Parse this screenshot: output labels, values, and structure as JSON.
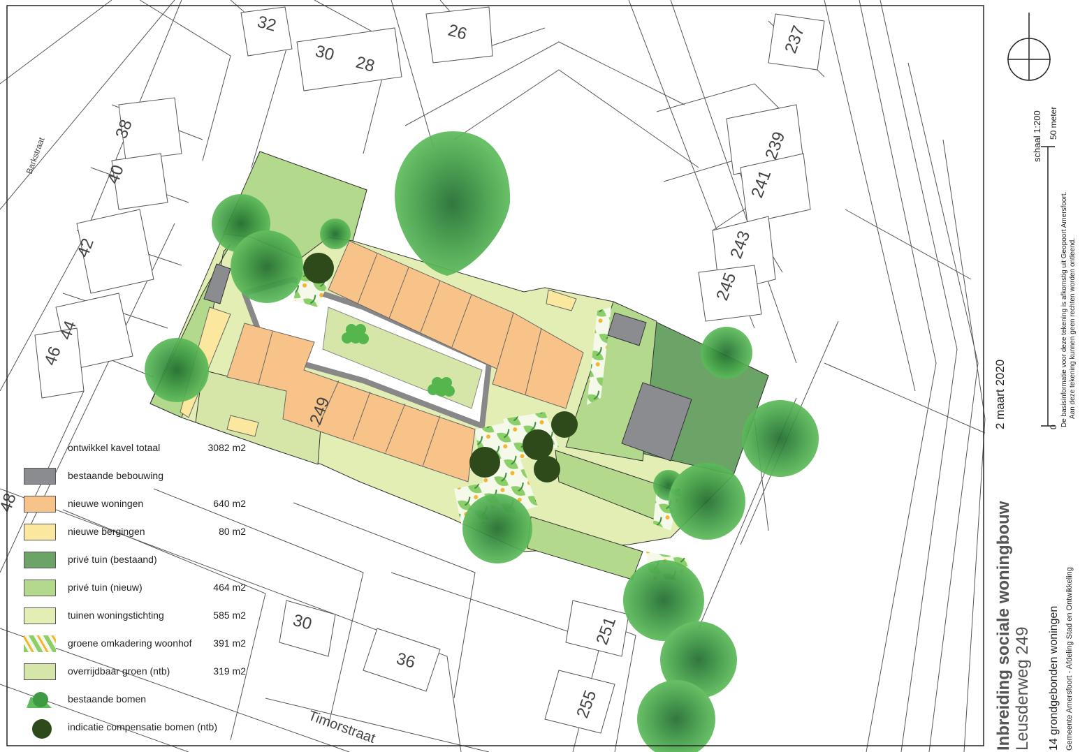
{
  "title": {
    "main": "Inbreiding sociale woningbouw",
    "location": "Leusderweg 249",
    "subtitle": "14 grondgebonden woningen",
    "org": "Gemeente Amersfoort - Afdeling Stad en Ontwikkeling"
  },
  "date": "2 maart 2020",
  "scale": {
    "ratio": "schaal 1:200",
    "length": "50 meter",
    "zero": "0"
  },
  "disclaimer": {
    "line1": "De basisinformatie voor deze tekening is afkomstig uit Geopoort Amersfoort.",
    "line2": "Aan deze tekening kunnen geen rechten worden ontleend."
  },
  "house_numbers": [
    "32",
    "26",
    "237",
    "30",
    "28",
    "38",
    "40",
    "42",
    "239",
    "241",
    "243",
    "245",
    "44",
    "46",
    "249",
    "48",
    "30",
    "36",
    "251",
    "255"
  ],
  "streets": [
    "Barkstraat",
    "Timorstraat"
  ],
  "legend": [
    {
      "label": "ontwikkel kavel totaal",
      "value": "3082 m2",
      "swatch": "none"
    },
    {
      "label": "bestaande bebouwing",
      "value": "",
      "swatch": "#8a8c8f"
    },
    {
      "label": "nieuwe woningen",
      "value": "640 m2",
      "swatch": "#f8c388"
    },
    {
      "label": "nieuwe bergingen",
      "value": "80 m2",
      "swatch": "#fbe79d"
    },
    {
      "label": "privé tuin (bestaand)",
      "value": "",
      "swatch": "#6ba466"
    },
    {
      "label": "privé tuin (nieuw)",
      "value": "464 m2",
      "swatch": "#b3d98c"
    },
    {
      "label": "tuinen woningstichting",
      "value": "585 m2",
      "swatch": "#e2eeb4"
    },
    {
      "label": "groene omkadering woonhof",
      "value": "391 m2",
      "swatch": "pattern"
    },
    {
      "label": "overrijdbaar groen (ntb)",
      "value": "319 m2",
      "swatch": "#d5e6a8"
    },
    {
      "label": "bestaande bomen",
      "value": "",
      "swatch": "tree"
    },
    {
      "label": "indicatie compensatie bomen (ntb)",
      "value": "",
      "swatch": "darktree"
    }
  ],
  "colors": {
    "existing_building": "#8a8c8f",
    "new_houses": "#f8c388",
    "new_storage": "#fbe79d",
    "private_garden_existing": "#6ba466",
    "private_garden_new": "#b3d98c",
    "gardens_housing_assoc": "#e2eeb4",
    "drivable_green": "#d5e6a8",
    "tree": "#3f9a45",
    "compensation_tree": "#2f4a1a"
  }
}
